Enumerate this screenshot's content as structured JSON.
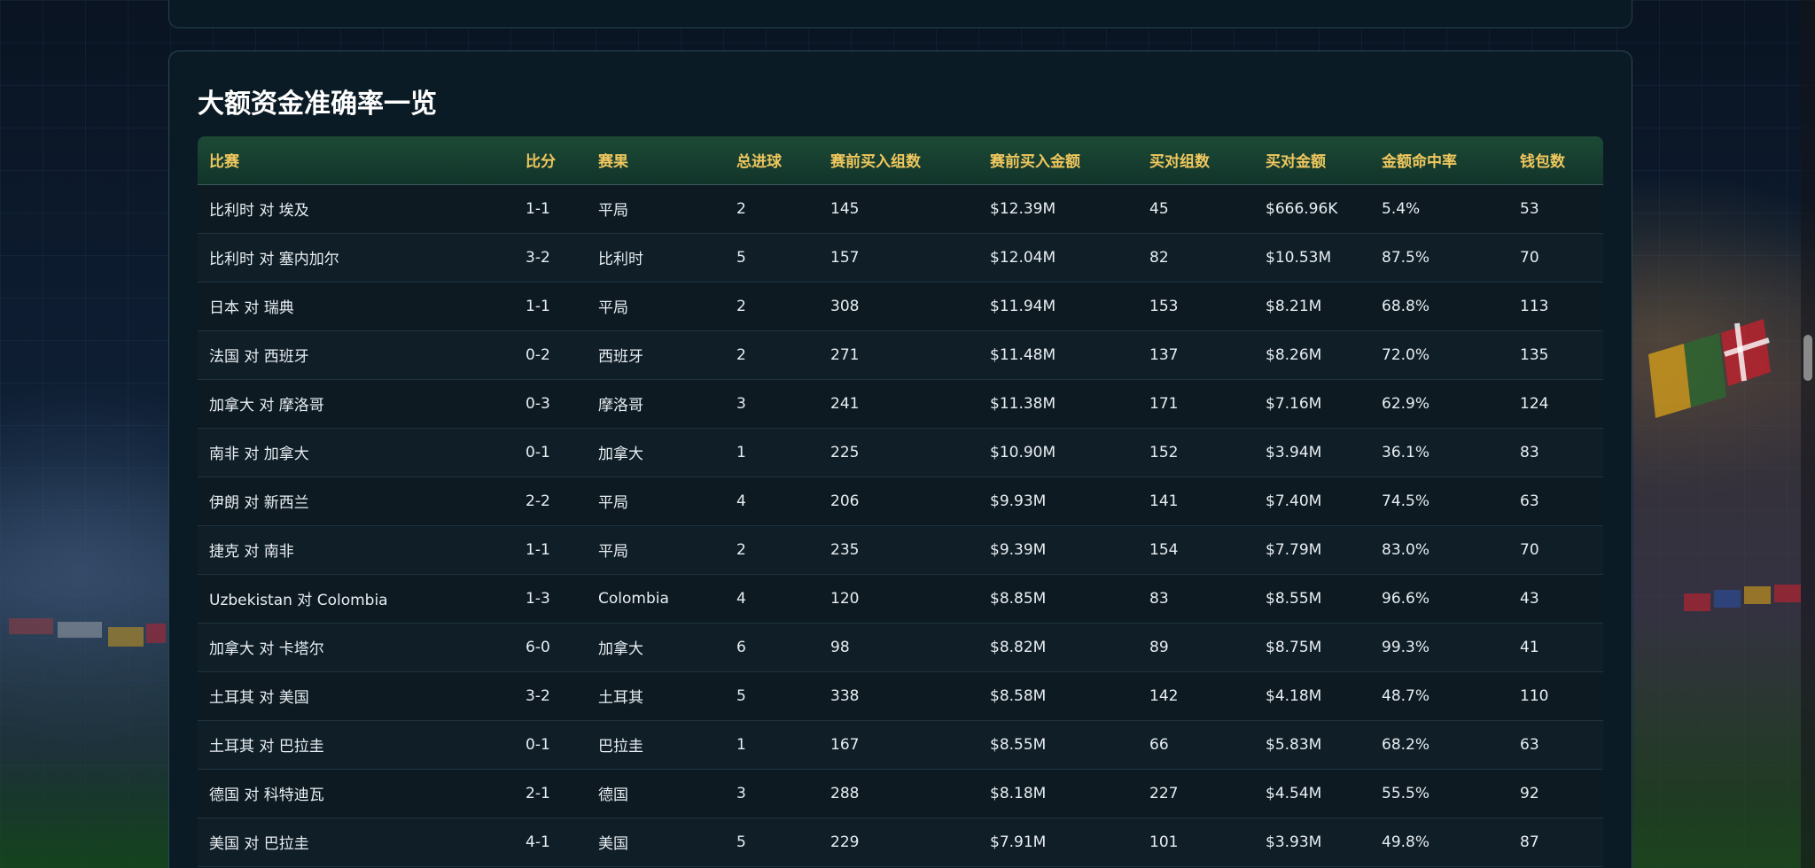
{
  "section": {
    "title": "大额资金准确率一览"
  },
  "table": {
    "columns": [
      "比赛",
      "比分",
      "赛果",
      "总进球",
      "赛前买入组数",
      "赛前买入金额",
      "买对组数",
      "买对金额",
      "金额命中率",
      "钱包数"
    ],
    "rows": [
      [
        "比利时 对 埃及",
        "1-1",
        "平局",
        "2",
        "145",
        "$12.39M",
        "45",
        "$666.96K",
        "5.4%",
        "53"
      ],
      [
        "比利时 对 塞内加尔",
        "3-2",
        "比利时",
        "5",
        "157",
        "$12.04M",
        "82",
        "$10.53M",
        "87.5%",
        "70"
      ],
      [
        "日本 对 瑞典",
        "1-1",
        "平局",
        "2",
        "308",
        "$11.94M",
        "153",
        "$8.21M",
        "68.8%",
        "113"
      ],
      [
        "法国 对 西班牙",
        "0-2",
        "西班牙",
        "2",
        "271",
        "$11.48M",
        "137",
        "$8.26M",
        "72.0%",
        "135"
      ],
      [
        "加拿大 对 摩洛哥",
        "0-3",
        "摩洛哥",
        "3",
        "241",
        "$11.38M",
        "171",
        "$7.16M",
        "62.9%",
        "124"
      ],
      [
        "南非 对 加拿大",
        "0-1",
        "加拿大",
        "1",
        "225",
        "$10.90M",
        "152",
        "$3.94M",
        "36.1%",
        "83"
      ],
      [
        "伊朗 对 新西兰",
        "2-2",
        "平局",
        "4",
        "206",
        "$9.93M",
        "141",
        "$7.40M",
        "74.5%",
        "63"
      ],
      [
        "捷克 对 南非",
        "1-1",
        "平局",
        "2",
        "235",
        "$9.39M",
        "154",
        "$7.79M",
        "83.0%",
        "70"
      ],
      [
        "Uzbekistan 对 Colombia",
        "1-3",
        "Colombia",
        "4",
        "120",
        "$8.85M",
        "83",
        "$8.55M",
        "96.6%",
        "43"
      ],
      [
        "加拿大 对 卡塔尔",
        "6-0",
        "加拿大",
        "6",
        "98",
        "$8.82M",
        "89",
        "$8.75M",
        "99.3%",
        "41"
      ],
      [
        "土耳其 对 美国",
        "3-2",
        "土耳其",
        "5",
        "338",
        "$8.58M",
        "142",
        "$4.18M",
        "48.7%",
        "110"
      ],
      [
        "土耳其 对 巴拉圭",
        "0-1",
        "巴拉圭",
        "1",
        "167",
        "$8.55M",
        "66",
        "$5.83M",
        "68.2%",
        "63"
      ],
      [
        "德国 对 科特迪瓦",
        "2-1",
        "德国",
        "3",
        "288",
        "$8.18M",
        "227",
        "$4.54M",
        "55.5%",
        "92"
      ],
      [
        "美国 对 巴拉圭",
        "4-1",
        "美国",
        "5",
        "229",
        "$7.91M",
        "101",
        "$3.93M",
        "49.8%",
        "87"
      ]
    ]
  },
  "colors": {
    "header_text": "#f0c75e",
    "header_bg": "#1c4a36",
    "card_bg": "#0b1b25",
    "text": "#e8eef2"
  }
}
